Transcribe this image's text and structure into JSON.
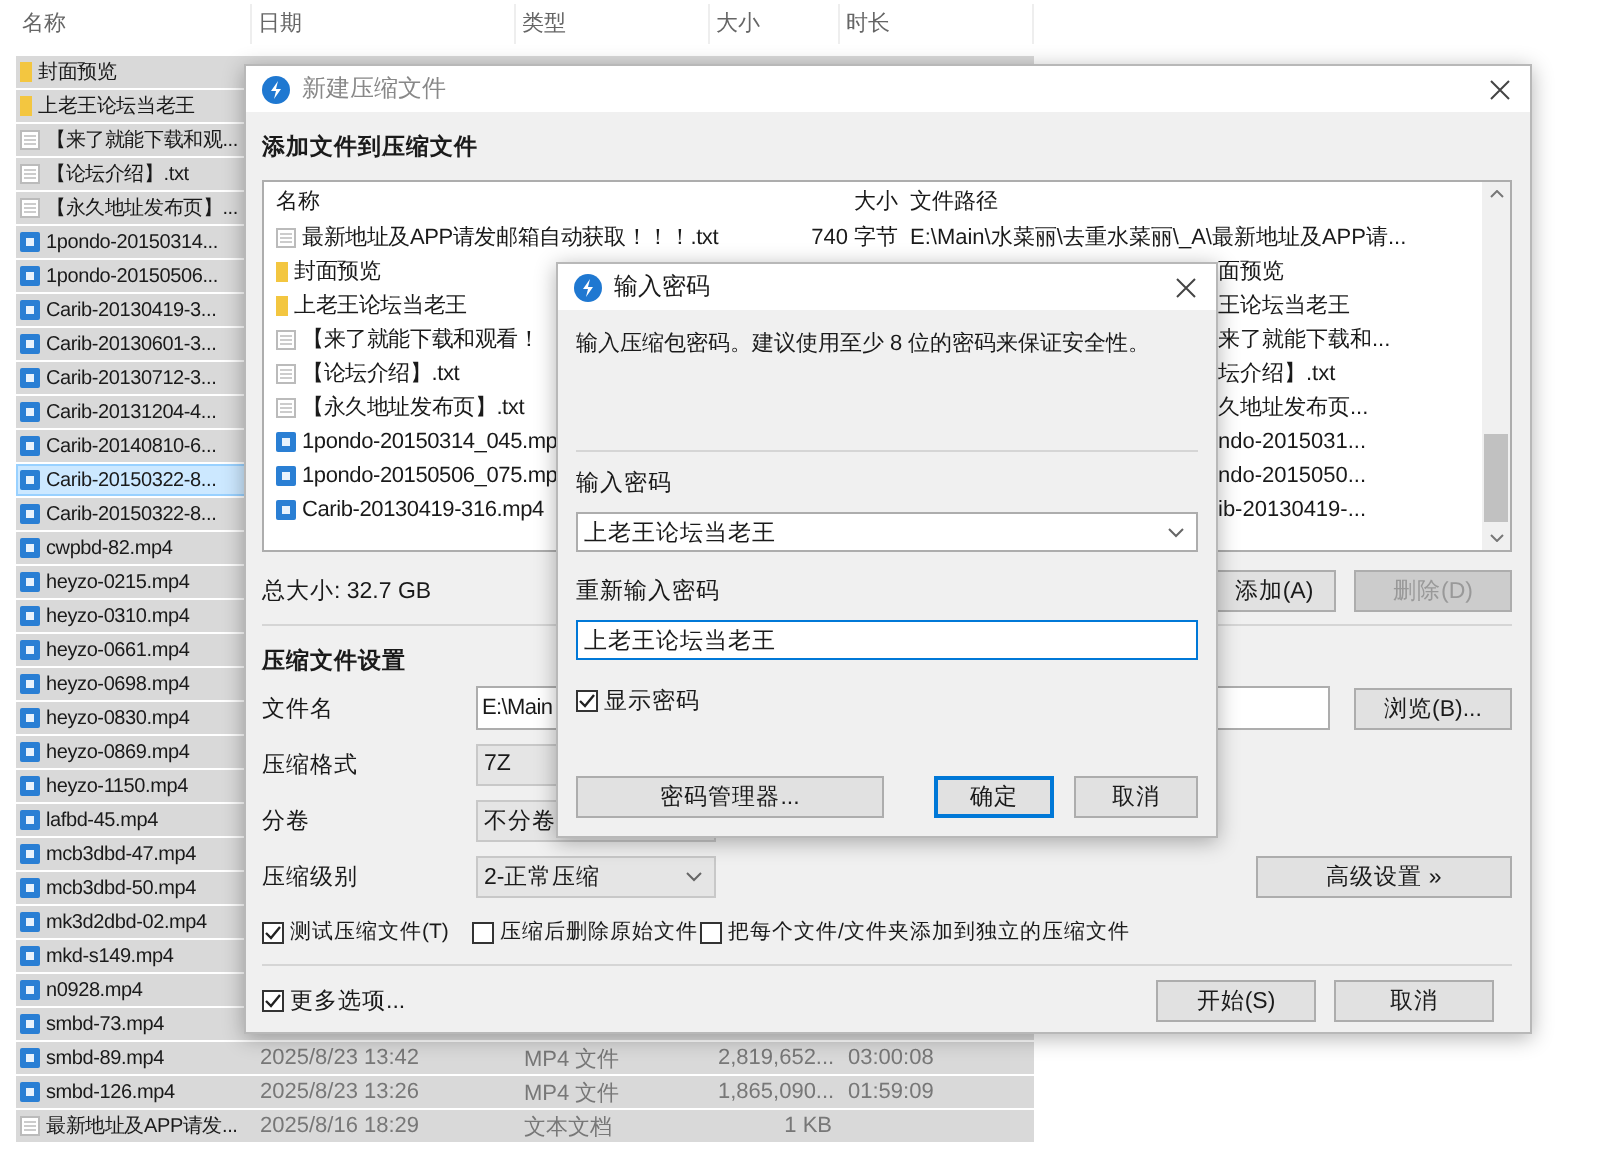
{
  "explorer": {
    "columns": [
      "名称",
      "日期",
      "类型",
      "大小",
      "时长"
    ],
    "rows": [
      {
        "name": "封面预览",
        "kind": "folder",
        "selected": true,
        "focused": false
      },
      {
        "name": "上老王论坛当老王",
        "kind": "folder",
        "selected": true,
        "focused": false
      },
      {
        "name": "【来了就能下载和观...",
        "kind": "text",
        "selected": true,
        "focused": false
      },
      {
        "name": "【论坛介绍】.txt",
        "kind": "text",
        "selected": true,
        "focused": false
      },
      {
        "name": "【永久地址发布页】...",
        "kind": "text",
        "selected": true,
        "focused": false
      },
      {
        "name": "1pondo-20150314...",
        "kind": "video",
        "selected": true,
        "focused": false
      },
      {
        "name": "1pondo-20150506...",
        "kind": "video",
        "selected": true,
        "focused": false
      },
      {
        "name": "Carib-20130419-3...",
        "kind": "video",
        "selected": true,
        "focused": false
      },
      {
        "name": "Carib-20130601-3...",
        "kind": "video",
        "selected": true,
        "focused": false
      },
      {
        "name": "Carib-20130712-3...",
        "kind": "video",
        "selected": true,
        "focused": false
      },
      {
        "name": "Carib-20131204-4...",
        "kind": "video",
        "selected": true,
        "focused": false
      },
      {
        "name": "Carib-20140810-6...",
        "kind": "video",
        "selected": true,
        "focused": false
      },
      {
        "name": "Carib-20150322-8...",
        "kind": "video",
        "selected": true,
        "focused": true
      },
      {
        "name": "Carib-20150322-8...",
        "kind": "video",
        "selected": true,
        "focused": false
      },
      {
        "name": "cwpbd-82.mp4",
        "kind": "video",
        "selected": true,
        "focused": false
      },
      {
        "name": "heyzo-0215.mp4",
        "kind": "video",
        "selected": true,
        "focused": false
      },
      {
        "name": "heyzo-0310.mp4",
        "kind": "video",
        "selected": true,
        "focused": false
      },
      {
        "name": "heyzo-0661.mp4",
        "kind": "video",
        "selected": true,
        "focused": false
      },
      {
        "name": "heyzo-0698.mp4",
        "kind": "video",
        "selected": true,
        "focused": false
      },
      {
        "name": "heyzo-0830.mp4",
        "kind": "video",
        "selected": true,
        "focused": false
      },
      {
        "name": "heyzo-0869.mp4",
        "kind": "video",
        "selected": true,
        "focused": false
      },
      {
        "name": "heyzo-1150.mp4",
        "kind": "video",
        "selected": true,
        "focused": false
      },
      {
        "name": "lafbd-45.mp4",
        "kind": "video",
        "selected": true,
        "focused": false
      },
      {
        "name": "mcb3dbd-47.mp4",
        "kind": "video",
        "selected": true,
        "focused": false
      },
      {
        "name": "mcb3dbd-50.mp4",
        "kind": "video",
        "selected": true,
        "focused": false
      },
      {
        "name": "mk3d2dbd-02.mp4",
        "kind": "video",
        "selected": true,
        "focused": false
      },
      {
        "name": "mkd-s149.mp4",
        "kind": "video",
        "selected": true,
        "focused": false
      },
      {
        "name": "n0928.mp4",
        "kind": "video",
        "selected": true,
        "focused": false
      },
      {
        "name": "smbd-73.mp4",
        "kind": "video",
        "selected": true,
        "focused": false
      },
      {
        "name": "smbd-89.mp4",
        "kind": "video",
        "selected": true,
        "focused": false,
        "date": "2025/8/23 13:42",
        "type": "MP4 文件",
        "size": "2,819,652...",
        "duration": "03:00:08"
      },
      {
        "name": "smbd-126.mp4",
        "kind": "video",
        "selected": true,
        "focused": false,
        "date": "2025/8/23 13:26",
        "type": "MP4 文件",
        "size": "1,865,090...",
        "duration": "01:59:09"
      },
      {
        "name": "最新地址及APP请发...",
        "kind": "text",
        "selected": true,
        "focused": false,
        "date": "2025/8/16 18:29",
        "type": "文本文档",
        "size": "1 KB"
      }
    ]
  },
  "archive_dialog": {
    "title": "新建压缩文件",
    "section_title": "添加文件到压缩文件",
    "file_list": {
      "columns": [
        "名称",
        "大小",
        "文件路径"
      ],
      "rows": [
        {
          "name": "最新地址及APP请发邮箱自动获取！！！.txt",
          "kind": "text",
          "size": "740 字节",
          "path": "E:\\Main\\水菜丽\\去重水菜丽\\_A\\最新地址及APP请...",
          "path_partial": false
        },
        {
          "name": "封面预览",
          "kind": "folder",
          "path": "面预览",
          "path_partial": true
        },
        {
          "name": "上老王论坛当老王",
          "kind": "folder",
          "path": "王论坛当老王",
          "path_partial": true
        },
        {
          "name": "【来了就能下载和观看！",
          "kind": "text",
          "path": "来了就能下载和...",
          "path_partial": true
        },
        {
          "name": "【论坛介绍】.txt",
          "kind": "text",
          "path": "坛介绍】.txt",
          "path_partial": true
        },
        {
          "name": "【永久地址发布页】.txt",
          "kind": "text",
          "path": "久地址发布页...",
          "path_partial": true
        },
        {
          "name": "1pondo-20150314_045.mp",
          "kind": "video",
          "path": "ndo-2015031...",
          "path_partial": true
        },
        {
          "name": "1pondo-20150506_075.mp",
          "kind": "video",
          "path": "ndo-2015050...",
          "path_partial": true
        },
        {
          "name": "Carib-20130419-316.mp4",
          "kind": "video",
          "path": "ib-20130419-...",
          "path_partial": true
        }
      ]
    },
    "total_size": "总大小: 32.7 GB",
    "add_button": {
      "label": "添加(A)",
      "disabled": false
    },
    "delete_button": {
      "label": "删除(D)",
      "disabled": true
    },
    "settings_title": "压缩文件设置",
    "fields": [
      {
        "label": "文件名",
        "kind": "text",
        "value": "E:\\Main"
      },
      {
        "label": "压缩格式",
        "kind": "combo",
        "value": "7Z"
      },
      {
        "label": "分卷",
        "kind": "combo",
        "value": "不分卷"
      },
      {
        "label": "压缩级别",
        "kind": "dropdown",
        "value": "2-正常压缩"
      }
    ],
    "browse_button": "浏览(B)...",
    "advanced_button": "高级设置 »",
    "options": [
      {
        "label": "测试压缩文件(T)",
        "checked": true
      },
      {
        "label": "压缩后删除原始文件",
        "checked": false
      },
      {
        "label": "把每个文件/文件夹添加到独立的压缩文件",
        "checked": false
      }
    ],
    "more_options": {
      "label": "更多选项...",
      "checked": true
    },
    "buttons": [
      "开始(S)",
      "取消"
    ]
  },
  "password_dialog": {
    "title": "输入密码",
    "hint": "输入压缩包密码。建议使用至少 8 位的密码来保证安全性。",
    "password_label": "输入密码",
    "password_value": "上老王论坛当老王",
    "confirm_label": "重新输入密码",
    "confirm_value": "上老王论坛当老王",
    "show_password": {
      "label": "显示密码",
      "checked": true
    },
    "buttons": [
      {
        "label": "密码管理器...",
        "default": false
      },
      {
        "label": "确定",
        "default": true
      },
      {
        "label": "取消",
        "default": false
      }
    ]
  }
}
